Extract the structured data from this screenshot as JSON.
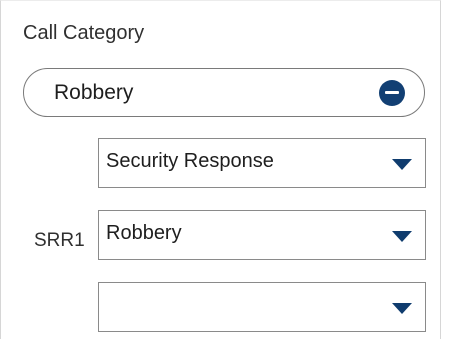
{
  "call_category": {
    "title": "Call Category",
    "selected_chip": {
      "label": "Robbery",
      "remove_icon": "minus-circle-icon"
    },
    "rows": [
      {
        "label": "",
        "value": "Security Response",
        "arrow_icon": "chevron-down-icon"
      },
      {
        "label": "SRR1",
        "value": "Robbery",
        "arrow_icon": "chevron-down-icon"
      },
      {
        "label": "",
        "value": "",
        "arrow_icon": "chevron-down-icon"
      }
    ]
  },
  "colors": {
    "accent": "#123f73",
    "border": "#8a8a8a",
    "text": "#1e1e1e"
  }
}
